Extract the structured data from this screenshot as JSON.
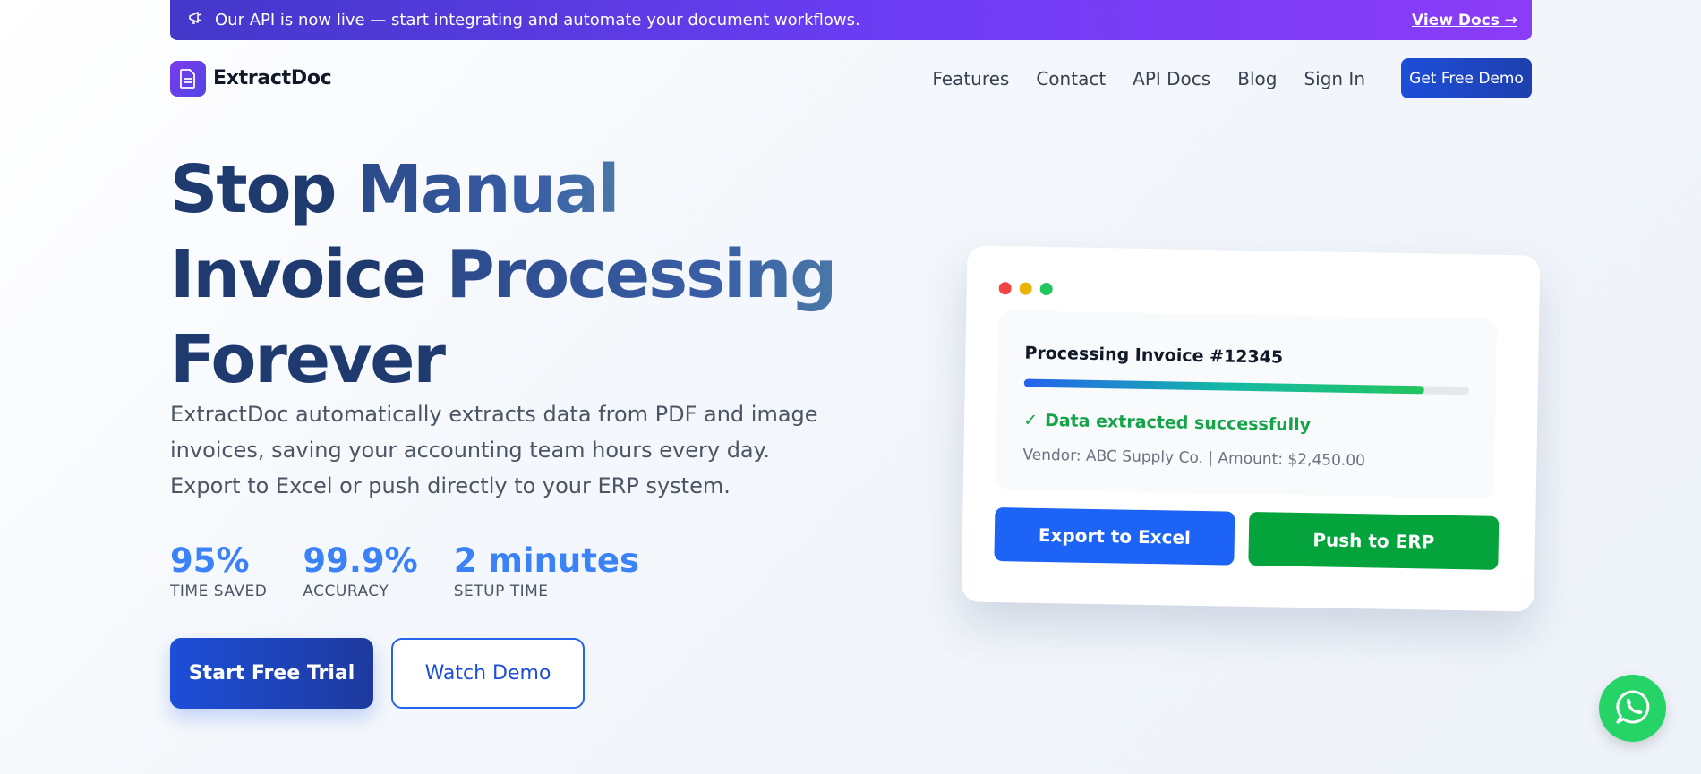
{
  "announcement": {
    "text": "Our API is now live — start integrating and automate your document workflows.",
    "link": "View Docs →",
    "icon": "megaphone-icon"
  },
  "nav": {
    "brand": "ExtractDoc",
    "links": [
      "Features",
      "Contact",
      "API Docs",
      "Blog",
      "Sign In"
    ],
    "cta": "Get Free Demo"
  },
  "hero": {
    "title_line1_a": "Stop ",
    "title_line1_b": "Manual",
    "title_line2_a": "Invoice ",
    "title_line2_b": "Processing",
    "title_line3": "Forever",
    "description": "ExtractDoc automatically extracts data from PDF and image invoices, saving your accounting team hours every day. Export to Excel or push directly to your ERP system.",
    "stats": [
      {
        "value": "95%",
        "label": "TIME SAVED"
      },
      {
        "value": "99.9%",
        "label": "ACCURACY"
      },
      {
        "value": "2 minutes",
        "label": "SETUP TIME"
      }
    ],
    "primary_button": "Start Free Trial",
    "secondary_button": "Watch Demo"
  },
  "card": {
    "window_dots": [
      "#ef4444",
      "#eab308",
      "#22c55e"
    ],
    "invoice_title": "Processing Invoice #12345",
    "progress": 0.9,
    "success_icon": "✓",
    "success_text": "Data extracted successfully",
    "meta": "Vendor: ABC Supply Co. | Amount: $2,450.00",
    "export_button": "Export to Excel",
    "erp_button": "Push to ERP"
  },
  "colors": {
    "accent": "#2563eb",
    "success": "#16a34a",
    "whatsapp": "#25d366"
  },
  "floating": {
    "icon": "whatsapp-icon"
  }
}
